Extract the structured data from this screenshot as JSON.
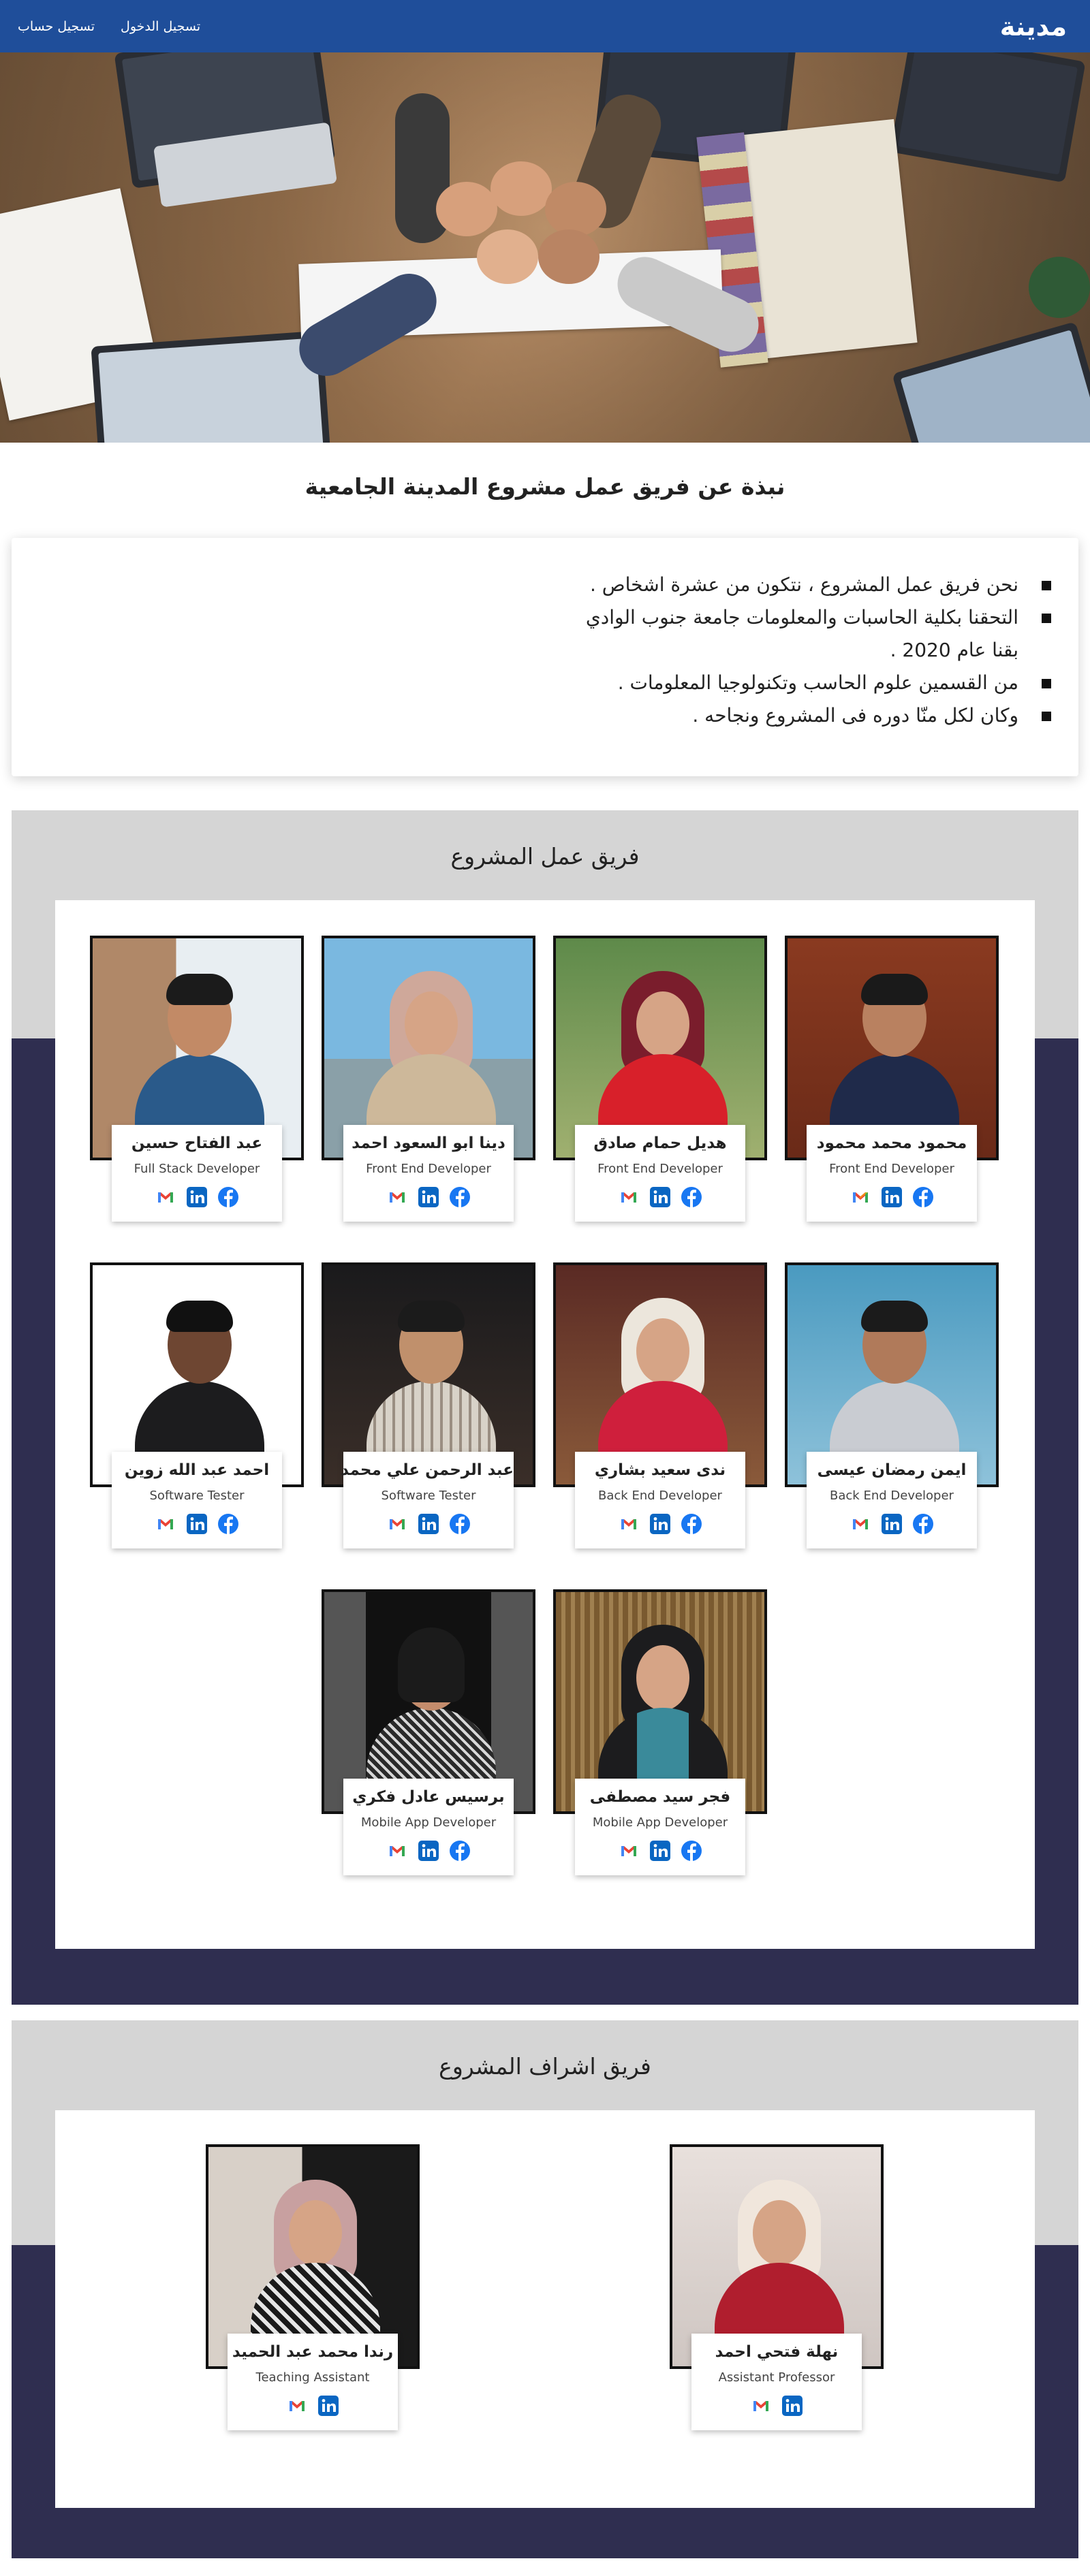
{
  "nav": {
    "brand": "مدينة",
    "login": "تسجيل الدخول",
    "register": "تسجيل حساب"
  },
  "about": {
    "title": "نبذة عن فريق عمل مشروع المدينة الجامعية",
    "points": [
      "نحن فريق عمل المشروع ، نتكون من عشرة اشخاص .",
      "التحقنا بكلية الحاسبات والمعلومات جامعة جنوب الوادي بقنا عام 2020 .",
      "من القسمين علوم الحاسب وتكنولوجيا المعلومات .",
      "وكان لكل منّا دوره فى المشروع ونجاحه ."
    ]
  },
  "team": {
    "title": "فريق عمل المشروع",
    "members": [
      {
        "name": "محمود محمد محمود",
        "role": "Front End Developer"
      },
      {
        "name": "هديل حمام صادق",
        "role": "Front End Developer"
      },
      {
        "name": "دينا ابو السعود احمد",
        "role": "Front End Developer"
      },
      {
        "name": "عبد الفتاح حسين",
        "role": "Full Stack Developer"
      },
      {
        "name": "ايمن رمضان عيسى",
        "role": "Back End Developer"
      },
      {
        "name": "ندى سعيد بشاري",
        "role": "Back End Developer"
      },
      {
        "name": "عبد الرحمن علي محمد",
        "role": "Software Tester"
      },
      {
        "name": "احمد عبد الله زوين",
        "role": "Software Tester"
      },
      {
        "name": "فجر سيد مصطفى",
        "role": "Mobile App Developer"
      },
      {
        "name": "برسيس عادل فكري",
        "role": "Mobile App Developer"
      }
    ]
  },
  "supervisors": {
    "title": "فريق اشراف المشروع",
    "members": [
      {
        "name": "نهلة فتحي احمد",
        "role": "Assistant Professor"
      },
      {
        "name": "رندا محمد عبد الحميد",
        "role": "Teaching Assistant"
      }
    ]
  },
  "colors": {
    "navbar": "#1f4e9a",
    "section_top": "#d5d5d5",
    "section_bottom": "#2f2e50",
    "linkedin": "#0a66c2",
    "facebook": "#1877f2"
  },
  "icons": [
    "gmail-icon",
    "linkedin-icon",
    "facebook-icon"
  ]
}
